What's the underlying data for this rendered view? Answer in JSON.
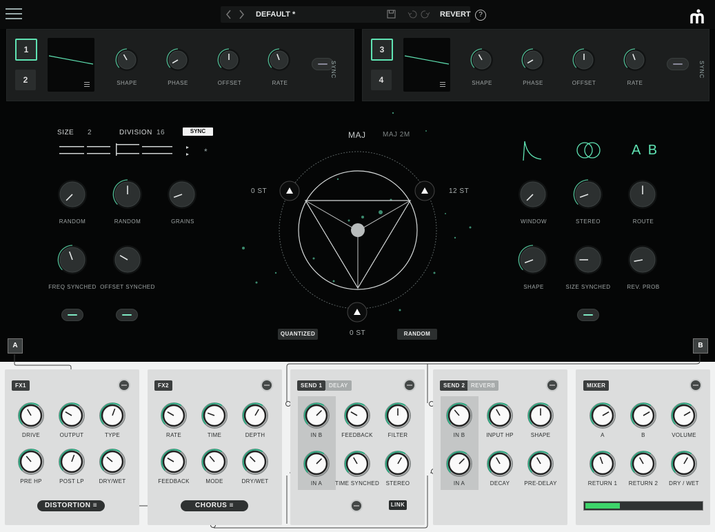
{
  "header": {
    "preset_name": "DEFAULT *",
    "revert_label": "REVERT",
    "help_label": "?",
    "icons": [
      "menu-icon",
      "chevron-left-icon",
      "chevron-right-icon",
      "save-icon",
      "undo-icon",
      "redo-icon",
      "help-icon",
      "logo-icon"
    ]
  },
  "lfo_left": {
    "buttons": [
      "1",
      "2"
    ],
    "knobs": [
      "SHAPE",
      "PHASE",
      "OFFSET",
      "RATE"
    ],
    "sync_label": "SYNC"
  },
  "lfo_right": {
    "buttons": [
      "3",
      "4"
    ],
    "knobs": [
      "SHAPE",
      "PHASE",
      "OFFSET",
      "RATE"
    ],
    "sync_label": "SYNC"
  },
  "grains": {
    "size_label": "SIZE",
    "size_value": "2",
    "division_label": "DIVISION",
    "division_value": "16",
    "sync_label": "SYNC",
    "knobs_row1": [
      "RANDOM",
      "RANDOM",
      "GRAINS"
    ],
    "knobs_row2": [
      "FREQ SYNCHED",
      "OFFSET SYNCHED"
    ]
  },
  "pitch": {
    "chord_primary": "MAJ",
    "chord_secondary": "MAJ 2M",
    "left_st": "0 ST",
    "right_st": "12 ST",
    "bottom_st": "0 ST",
    "quantized_label": "QUANTIZED",
    "random_label": "RANDOM"
  },
  "env": {
    "ab_label": "A B",
    "knobs_row1": [
      "WINDOW",
      "STEREO",
      "ROUTE"
    ],
    "knobs_row2": [
      "SHAPE",
      "SIZE SYNCHED",
      "REV. PROB"
    ]
  },
  "routing": {
    "a_label": "A",
    "b_label": "B"
  },
  "fx1": {
    "tag": "FX1",
    "knobs": [
      "DRIVE",
      "OUTPUT",
      "TYPE",
      "PRE HP",
      "POST LP",
      "DRY/WET"
    ],
    "type_label": "DISTORTION"
  },
  "fx2": {
    "tag": "FX2",
    "knobs": [
      "RATE",
      "TIME",
      "DEPTH",
      "FEEDBACK",
      "MODE",
      "DRY/WET"
    ],
    "type_label": "CHORUS"
  },
  "send1": {
    "tag": "SEND 1",
    "type": "DELAY",
    "knobs": [
      "IN B",
      "FEEDBACK",
      "FILTER",
      "IN A",
      "TIME SYNCHED",
      "STEREO"
    ],
    "link_label": "LINK"
  },
  "send2": {
    "tag": "SEND 2",
    "type": "REVERB",
    "knobs": [
      "IN B",
      "INPUT HP",
      "SHAPE",
      "IN A",
      "DECAY",
      "PRE-DELAY"
    ]
  },
  "mixer": {
    "tag": "MIXER",
    "knobs": [
      "A",
      "B",
      "VOLUME",
      "RETURN 1",
      "RETURN 2",
      "DRY / WET"
    ],
    "meter_level": 0.3
  },
  "colors": {
    "accent": "#5fe3b3",
    "panel_dark": "#1c1e1e",
    "panel_light": "#dcdddd"
  }
}
